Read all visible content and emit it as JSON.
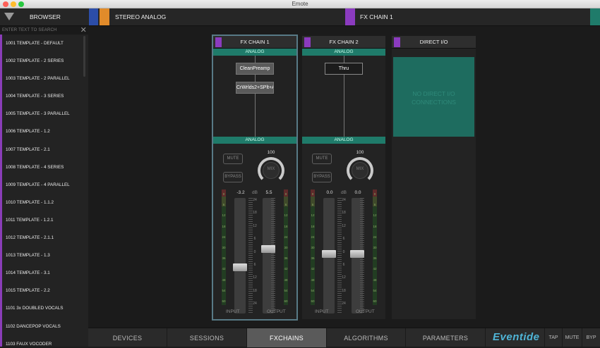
{
  "window": {
    "title": "Emote"
  },
  "topbar": {
    "browser_label": "BROWSER",
    "routing_label": "STEREO ANALOG",
    "chain_label": "FX CHAIN 1"
  },
  "sidebar": {
    "search_placeholder": "ENTER TEXT TO SEARCH",
    "items": [
      "1001 TEMPLATE - DEFAULT",
      "1002 TEMPLATE - 2 SERIES",
      "1003 TEMPLATE - 2 PARALLEL",
      "1004 TEMPLATE - 3 SERIES",
      "1005 TEMPLATE - 3 PARALLEL",
      "1006 TEMPLATE - 1.2",
      "1007 TEMPLATE - 2.1",
      "1008 TEMPLATE - 4 SERIES",
      "1009 TEMPLATE - 4 PARALLEL",
      "1010 TEMPLATE - 1.1.2",
      "1011 TEMPLATE - 1.2.1",
      "1012 TEMPLATE - 2.1.1",
      "1013 TEMPLATE - 1.3",
      "1014 TEMPLATE - 3.1",
      "1015 TEMPLATE - 2.2",
      "1101 3x DOUBLED VOCALS",
      "1102 DANCEPOP VOCALS",
      "1103 FAUX VOCODER"
    ]
  },
  "chains": [
    {
      "title": "FX CHAIN 1",
      "in_label": "ANALOG",
      "out_label": "ANALOG",
      "blocks": [
        "CleanPreamp",
        "CrWrlds2+SPlt+A..."
      ],
      "mute": "MUTE",
      "bypass": "BYPASS",
      "mix_label": "MIX",
      "mix_value": "100",
      "input_db": "-3.2",
      "output_db": "5.5",
      "db_label": "dB",
      "input_label": "INPUT",
      "output_label": "OUTPUT",
      "input_fader": -6.4,
      "output_fader": 2.1
    },
    {
      "title": "FX CHAIN 2",
      "in_label": "ANALOG",
      "out_label": "ANALOG",
      "blocks": [
        "Thru"
      ],
      "mute": "MUTE",
      "bypass": "BYPASS",
      "mix_label": "MIX",
      "mix_value": "100",
      "input_db": "0.0",
      "output_db": "0.0",
      "db_label": "dB",
      "input_label": "INPUT",
      "output_label": "OUTPUT",
      "input_fader": 0.0,
      "output_fader": 0.0
    }
  ],
  "direct": {
    "title": "DIRECT I/O",
    "message": "NO DIRECT I/O CONNECTIONS"
  },
  "scale": [
    "24",
    "18",
    "12",
    "6",
    "0",
    "6",
    "12",
    "18",
    "24"
  ],
  "meter_scale": [
    "0",
    "6",
    "12",
    "18",
    "24",
    "30",
    "36",
    "42",
    "48",
    "54",
    "60"
  ],
  "tabs": [
    "DEVICES",
    "SESSIONS",
    "FXCHAINS",
    "ALGORITHMS",
    "PARAMETERS"
  ],
  "active_tab": "FXCHAINS",
  "logo": "Eventide",
  "buttons": {
    "tap": "TAP",
    "mute": "MUTE",
    "byp": "BYP"
  },
  "colors": {
    "accent_purple": "#8b3bbf",
    "analog_teal": "#1f7b6a",
    "logo_blue": "#4fb5d7"
  }
}
